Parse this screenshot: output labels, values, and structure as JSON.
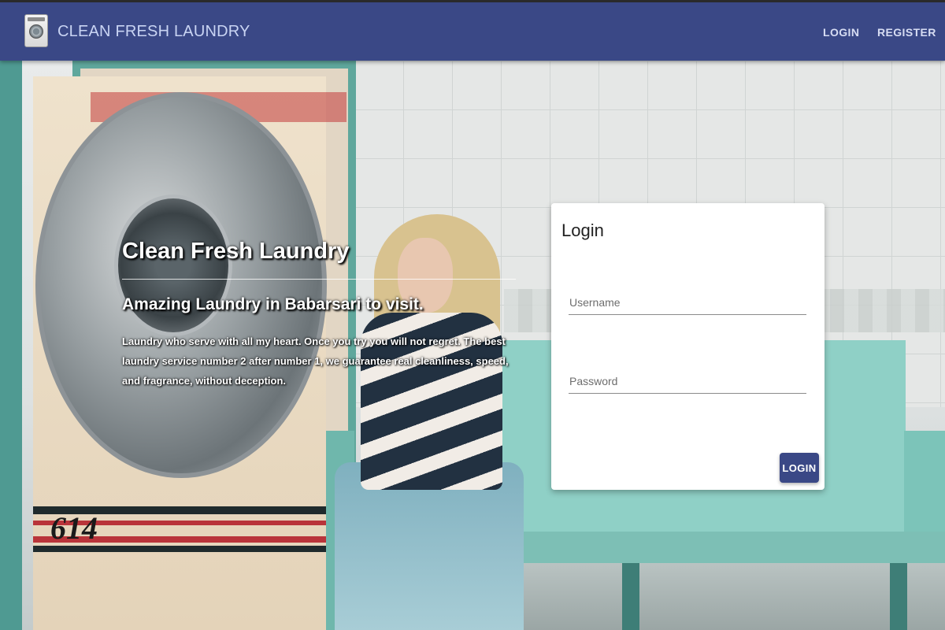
{
  "header": {
    "brand": "CLEAN FRESH LAUNDRY",
    "logo_icon": "washing-machine-icon",
    "nav": {
      "login_label": "LOGIN",
      "register_label": "REGISTER"
    },
    "background_color": "#3a4886"
  },
  "hero": {
    "title": "Clean Fresh Laundry",
    "subtitle": "Amazing Laundry in Babarsari to visit.",
    "description": "Laundry who serve with all my heart. Once you try you will not regret. The best laundry service number 2 after number 1, we guarantee real cleanliness, speed, and fragrance, without deception."
  },
  "background_scene": {
    "machine_number": "614"
  },
  "login_card": {
    "title": "Login",
    "username_placeholder": "Username",
    "username_value": "",
    "password_placeholder": "Password",
    "password_value": "",
    "submit_label": "LOGIN",
    "accent_color": "#3a4886"
  }
}
